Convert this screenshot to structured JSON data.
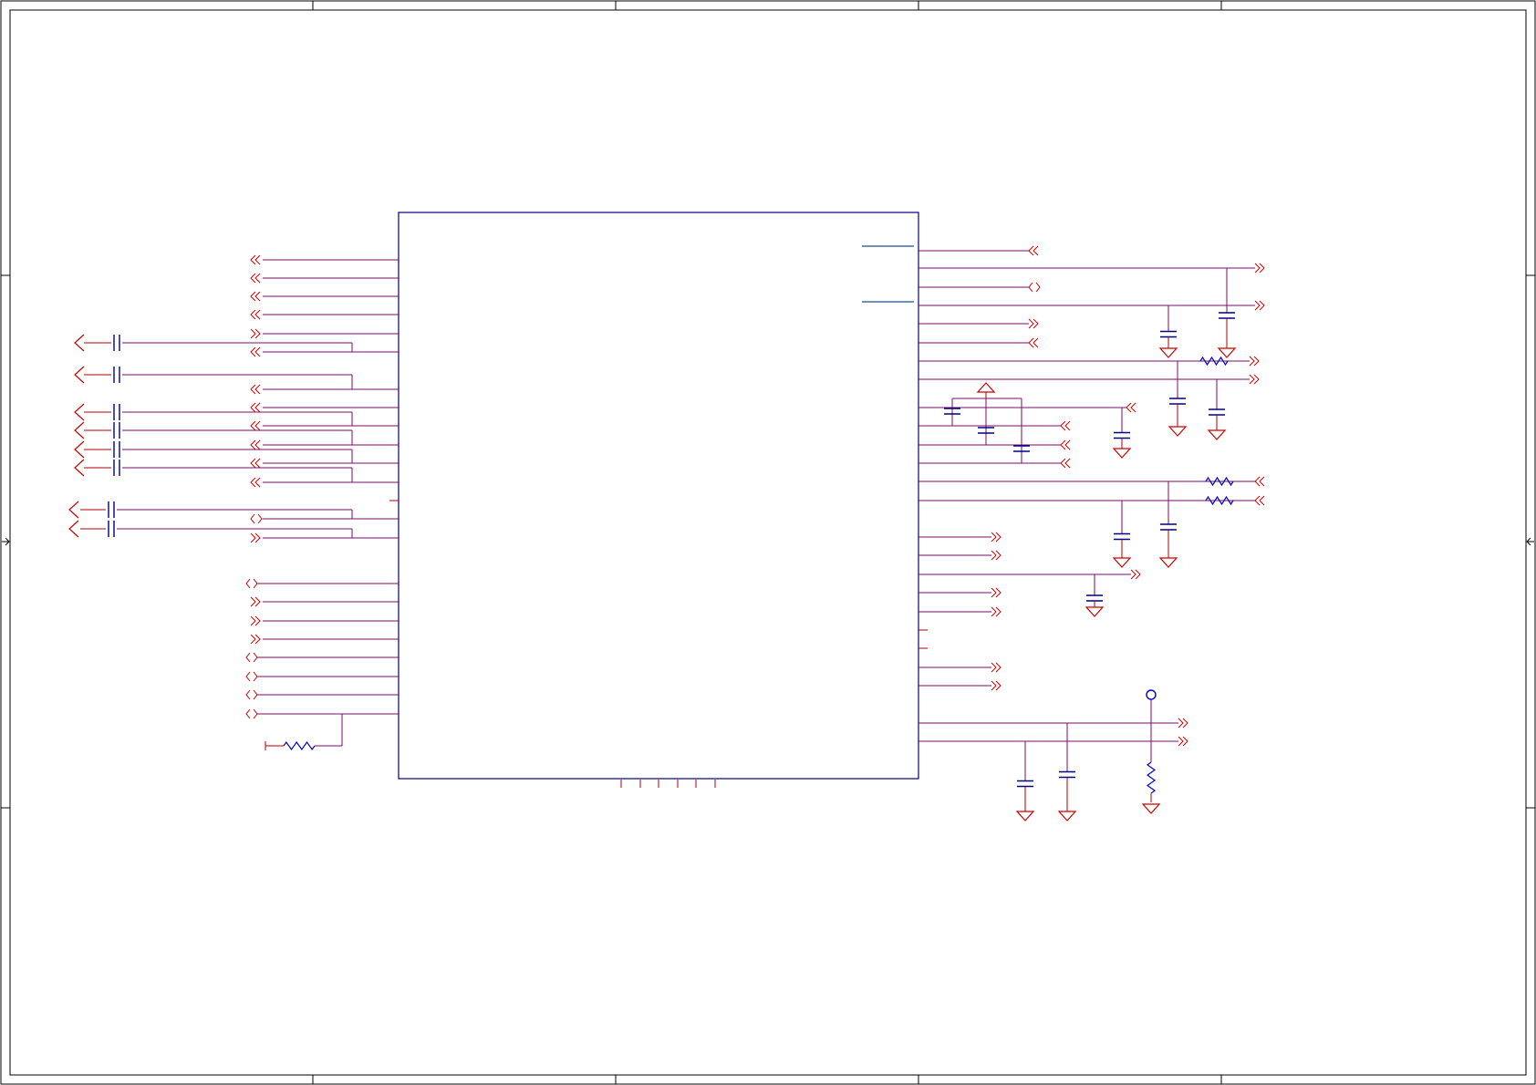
{
  "sheet": {
    "zones_top": [
      "",
      "",
      "",
      "",
      ""
    ],
    "zones_side": [
      "",
      "",
      ""
    ]
  },
  "components": {
    "main_ic": "",
    "capacitors": [],
    "resistors": [],
    "test_point": ""
  },
  "colors": {
    "frame": "#000000",
    "ic_outline": "#00007f",
    "wire": "#b00000",
    "net": "#7a0b6e",
    "port": "#cc0000",
    "capacitor": "#00007f",
    "resistor": "#0000cc",
    "ground": "#cc0000"
  },
  "icons": [
    "offpage-connector-icon",
    "ground-symbol-icon",
    "power-symbol-icon",
    "capacitor-icon",
    "resistor-icon",
    "test-point-icon"
  ]
}
